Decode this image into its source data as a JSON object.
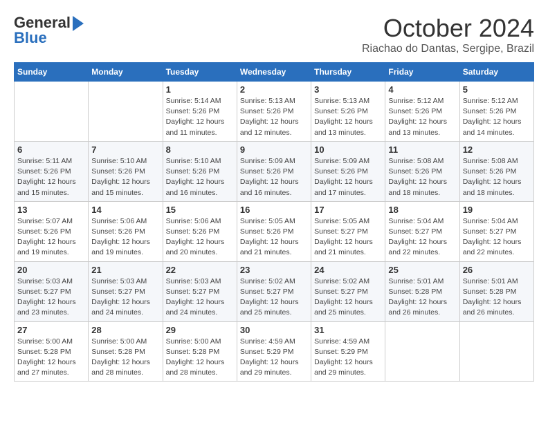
{
  "header": {
    "logo_general": "General",
    "logo_blue": "Blue",
    "month": "October 2024",
    "location": "Riachao do Dantas, Sergipe, Brazil"
  },
  "weekdays": [
    "Sunday",
    "Monday",
    "Tuesday",
    "Wednesday",
    "Thursday",
    "Friday",
    "Saturday"
  ],
  "weeks": [
    [
      {
        "day": "",
        "info": ""
      },
      {
        "day": "",
        "info": ""
      },
      {
        "day": "1",
        "info": "Sunrise: 5:14 AM\nSunset: 5:26 PM\nDaylight: 12 hours and 11 minutes."
      },
      {
        "day": "2",
        "info": "Sunrise: 5:13 AM\nSunset: 5:26 PM\nDaylight: 12 hours and 12 minutes."
      },
      {
        "day": "3",
        "info": "Sunrise: 5:13 AM\nSunset: 5:26 PM\nDaylight: 12 hours and 13 minutes."
      },
      {
        "day": "4",
        "info": "Sunrise: 5:12 AM\nSunset: 5:26 PM\nDaylight: 12 hours and 13 minutes."
      },
      {
        "day": "5",
        "info": "Sunrise: 5:12 AM\nSunset: 5:26 PM\nDaylight: 12 hours and 14 minutes."
      }
    ],
    [
      {
        "day": "6",
        "info": "Sunrise: 5:11 AM\nSunset: 5:26 PM\nDaylight: 12 hours and 15 minutes."
      },
      {
        "day": "7",
        "info": "Sunrise: 5:10 AM\nSunset: 5:26 PM\nDaylight: 12 hours and 15 minutes."
      },
      {
        "day": "8",
        "info": "Sunrise: 5:10 AM\nSunset: 5:26 PM\nDaylight: 12 hours and 16 minutes."
      },
      {
        "day": "9",
        "info": "Sunrise: 5:09 AM\nSunset: 5:26 PM\nDaylight: 12 hours and 16 minutes."
      },
      {
        "day": "10",
        "info": "Sunrise: 5:09 AM\nSunset: 5:26 PM\nDaylight: 12 hours and 17 minutes."
      },
      {
        "day": "11",
        "info": "Sunrise: 5:08 AM\nSunset: 5:26 PM\nDaylight: 12 hours and 18 minutes."
      },
      {
        "day": "12",
        "info": "Sunrise: 5:08 AM\nSunset: 5:26 PM\nDaylight: 12 hours and 18 minutes."
      }
    ],
    [
      {
        "day": "13",
        "info": "Sunrise: 5:07 AM\nSunset: 5:26 PM\nDaylight: 12 hours and 19 minutes."
      },
      {
        "day": "14",
        "info": "Sunrise: 5:06 AM\nSunset: 5:26 PM\nDaylight: 12 hours and 19 minutes."
      },
      {
        "day": "15",
        "info": "Sunrise: 5:06 AM\nSunset: 5:26 PM\nDaylight: 12 hours and 20 minutes."
      },
      {
        "day": "16",
        "info": "Sunrise: 5:05 AM\nSunset: 5:26 PM\nDaylight: 12 hours and 21 minutes."
      },
      {
        "day": "17",
        "info": "Sunrise: 5:05 AM\nSunset: 5:27 PM\nDaylight: 12 hours and 21 minutes."
      },
      {
        "day": "18",
        "info": "Sunrise: 5:04 AM\nSunset: 5:27 PM\nDaylight: 12 hours and 22 minutes."
      },
      {
        "day": "19",
        "info": "Sunrise: 5:04 AM\nSunset: 5:27 PM\nDaylight: 12 hours and 22 minutes."
      }
    ],
    [
      {
        "day": "20",
        "info": "Sunrise: 5:03 AM\nSunset: 5:27 PM\nDaylight: 12 hours and 23 minutes."
      },
      {
        "day": "21",
        "info": "Sunrise: 5:03 AM\nSunset: 5:27 PM\nDaylight: 12 hours and 24 minutes."
      },
      {
        "day": "22",
        "info": "Sunrise: 5:03 AM\nSunset: 5:27 PM\nDaylight: 12 hours and 24 minutes."
      },
      {
        "day": "23",
        "info": "Sunrise: 5:02 AM\nSunset: 5:27 PM\nDaylight: 12 hours and 25 minutes."
      },
      {
        "day": "24",
        "info": "Sunrise: 5:02 AM\nSunset: 5:27 PM\nDaylight: 12 hours and 25 minutes."
      },
      {
        "day": "25",
        "info": "Sunrise: 5:01 AM\nSunset: 5:28 PM\nDaylight: 12 hours and 26 minutes."
      },
      {
        "day": "26",
        "info": "Sunrise: 5:01 AM\nSunset: 5:28 PM\nDaylight: 12 hours and 26 minutes."
      }
    ],
    [
      {
        "day": "27",
        "info": "Sunrise: 5:00 AM\nSunset: 5:28 PM\nDaylight: 12 hours and 27 minutes."
      },
      {
        "day": "28",
        "info": "Sunrise: 5:00 AM\nSunset: 5:28 PM\nDaylight: 12 hours and 28 minutes."
      },
      {
        "day": "29",
        "info": "Sunrise: 5:00 AM\nSunset: 5:28 PM\nDaylight: 12 hours and 28 minutes."
      },
      {
        "day": "30",
        "info": "Sunrise: 4:59 AM\nSunset: 5:29 PM\nDaylight: 12 hours and 29 minutes."
      },
      {
        "day": "31",
        "info": "Sunrise: 4:59 AM\nSunset: 5:29 PM\nDaylight: 12 hours and 29 minutes."
      },
      {
        "day": "",
        "info": ""
      },
      {
        "day": "",
        "info": ""
      }
    ]
  ]
}
